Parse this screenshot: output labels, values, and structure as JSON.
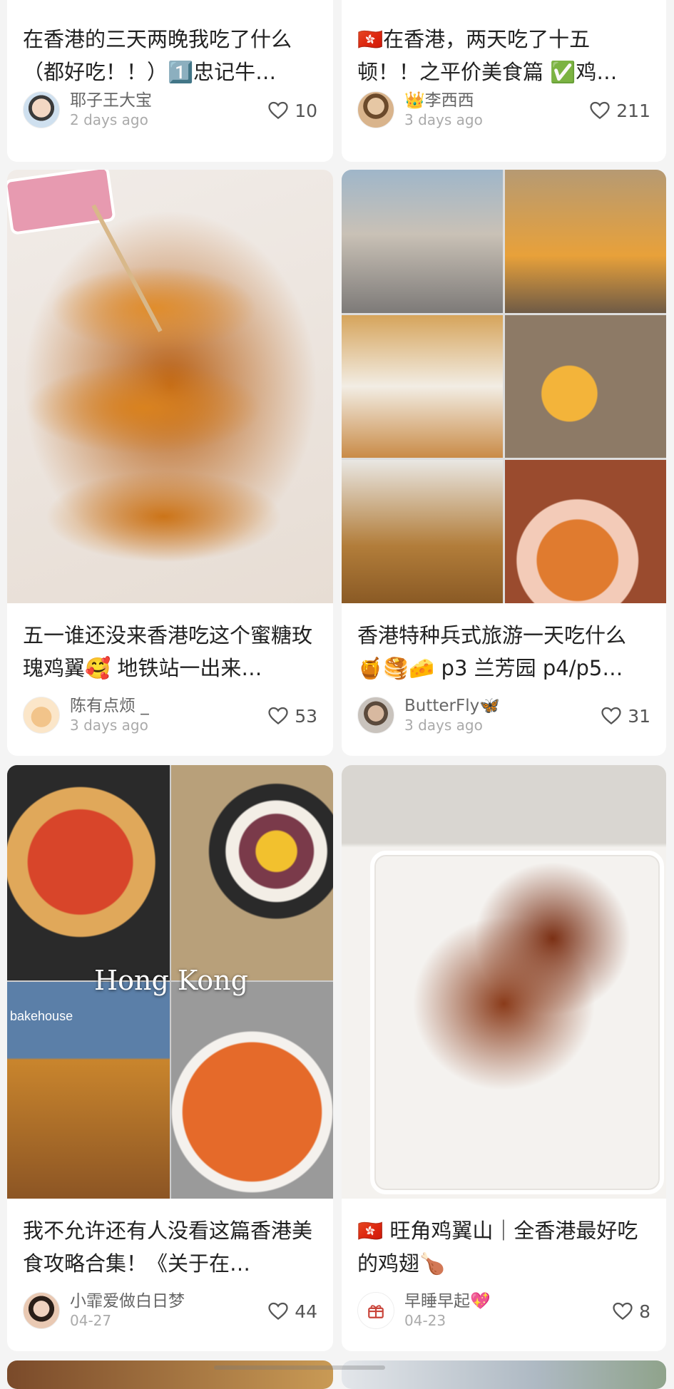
{
  "cards": [
    {
      "title": "在香港的三天两晚我吃了什么（都好吃！！）1️⃣忠记牛…",
      "author": "耶子王大宝",
      "time": "2 days ago",
      "likes": "10"
    },
    {
      "title": "🇭🇰在香港，两天吃了十五顿！！之平价美食篇 ✅鸡…",
      "author": "👑李西西",
      "time": "3 days ago",
      "likes": "211"
    },
    {
      "title": "五一谁还没来香港吃这个蜜糖玫瑰鸡翼🥰 地铁站一出来…",
      "author": "陈有点烦 _",
      "time": "3 days ago",
      "likes": "53"
    },
    {
      "title": "香港特种兵式旅游一天吃什么🍯🥞🧀 p3 兰芳园 p4/p5…",
      "author": "ButterFly🦋",
      "time": "3 days ago",
      "likes": "31"
    },
    {
      "title": "我不允许还有人没看这篇香港美食攻略合集！《关于在…",
      "author": "小霏爱做白日梦",
      "time": "04-27",
      "likes": "44",
      "image_overlay": "Hong Kong",
      "image_logo": "bakehouse"
    },
    {
      "title": "🇭🇰 旺角鸡翼山｜全香港最好吃的鸡翅🍗",
      "author": "早睡早起💖",
      "time": "04-23",
      "likes": "8"
    }
  ],
  "icons": {
    "like": "heart-outline-icon",
    "gift": "gift-icon"
  },
  "colors": {
    "background": "#f4f4f4",
    "card": "#ffffff",
    "text": "#222222",
    "meta": "#aaaaaa"
  }
}
